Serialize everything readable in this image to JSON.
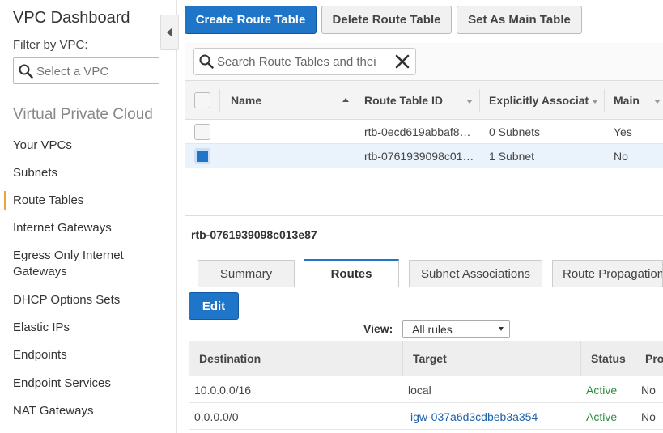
{
  "sidebar": {
    "title": "VPC Dashboard",
    "filter_label": "Filter by VPC:",
    "filter_placeholder": "Select a VPC",
    "section_title": "Virtual Private Cloud",
    "items": [
      {
        "label": "Your VPCs"
      },
      {
        "label": "Subnets"
      },
      {
        "label": "Route Tables"
      },
      {
        "label": "Internet Gateways"
      },
      {
        "label": "Egress Only Internet Gateways"
      },
      {
        "label": "DHCP Options Sets"
      },
      {
        "label": "Elastic IPs"
      },
      {
        "label": "Endpoints"
      },
      {
        "label": "Endpoint Services"
      },
      {
        "label": "NAT Gateways"
      }
    ],
    "active_item": "Route Tables",
    "indicator_color": "#f0a33a"
  },
  "toolbar": {
    "create_label": "Create Route Table",
    "delete_label": "Delete Route Table",
    "set_main_label": "Set As Main Table"
  },
  "search": {
    "placeholder": "Search Route Tables and thei"
  },
  "table": {
    "columns": [
      "Name",
      "Route Table ID",
      "Explicitly Associat",
      "Main"
    ],
    "rows": [
      {
        "name": "",
        "id": "rtb-0ecd619abbaf8…",
        "assoc": "0 Subnets",
        "main": "Yes",
        "selected": false
      },
      {
        "name": "",
        "id": "rtb-0761939098c01…",
        "assoc": "1 Subnet",
        "main": "No",
        "selected": true
      }
    ]
  },
  "detail": {
    "title": "rtb-0761939098c013e87",
    "tabs": [
      "Summary",
      "Routes",
      "Subnet Associations",
      "Route Propagation"
    ],
    "active_tab": "Routes",
    "edit_label": "Edit",
    "view_label": "View:",
    "view_value": "All rules",
    "routes_columns": [
      "Destination",
      "Target",
      "Status",
      "Pro"
    ],
    "routes": [
      {
        "destination": "10.0.0.0/16",
        "target": "local",
        "status": "Active",
        "propagated": "No"
      },
      {
        "destination": "0.0.0.0/0",
        "target": "igw-037a6d3cdbeb3a354",
        "status": "Active",
        "propagated": "No"
      }
    ]
  },
  "colors": {
    "primary": "#1f76c8",
    "active_status": "#2e8b3d",
    "link": "#1f62a8"
  }
}
